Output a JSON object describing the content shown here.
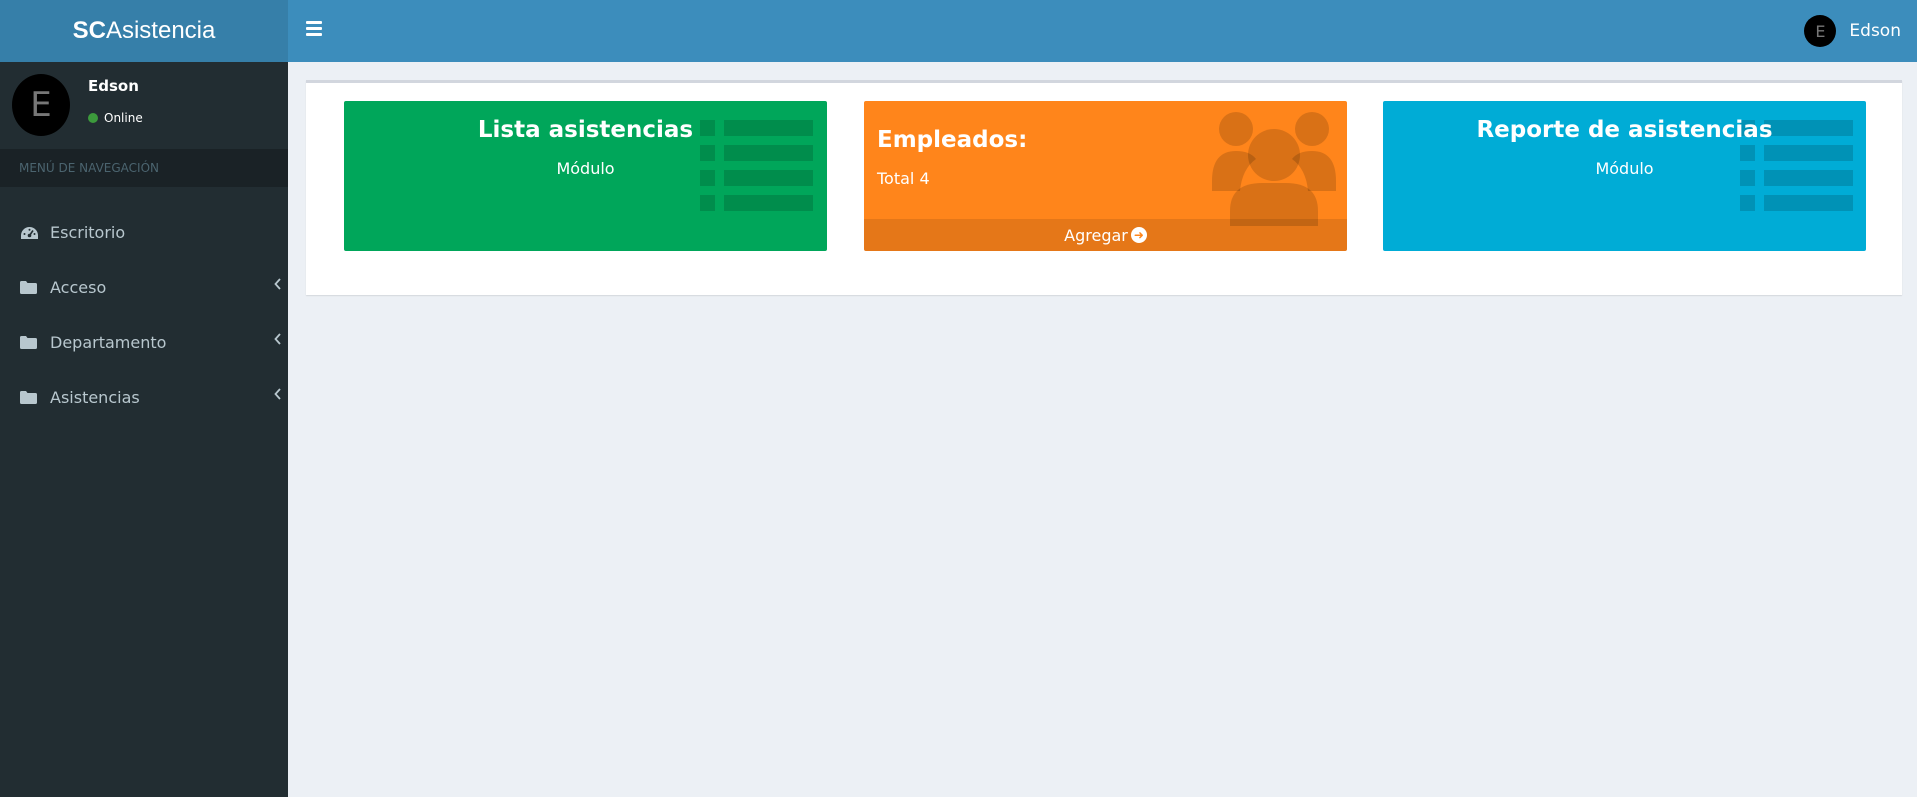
{
  "header": {
    "logo_bold": "SC",
    "logo_rest": "Asistencia",
    "user_initial": "E",
    "user_name": "Edson"
  },
  "sidebar": {
    "user_initial": "E",
    "user_name": "Edson",
    "status": "Online",
    "nav_header": "MENÚ DE NAVEGACIÓN",
    "items": [
      {
        "label": "Escritorio",
        "icon": "dashboard-icon"
      },
      {
        "label": "Acceso",
        "icon": "folder-icon"
      },
      {
        "label": "Departamento",
        "icon": "folder-icon"
      },
      {
        "label": "Asistencias",
        "icon": "folder-icon"
      }
    ]
  },
  "tiles": [
    {
      "title": "Lista asistencias",
      "subtitle": "Módulo",
      "color": "#00a65a",
      "icon": "list-icon"
    },
    {
      "title": "Empleados:",
      "subtitle": "Total 4",
      "footer": "Agregar",
      "color": "#ff851b",
      "icon": "users-icon"
    },
    {
      "title": "Reporte de asistencias",
      "subtitle": "Módulo",
      "color": "#00acd6",
      "icon": "list-icon"
    }
  ],
  "colors": {
    "header": "#3c8dbc",
    "logo": "#367fa9",
    "sidebar": "#222d32",
    "background": "#ecf0f5"
  }
}
